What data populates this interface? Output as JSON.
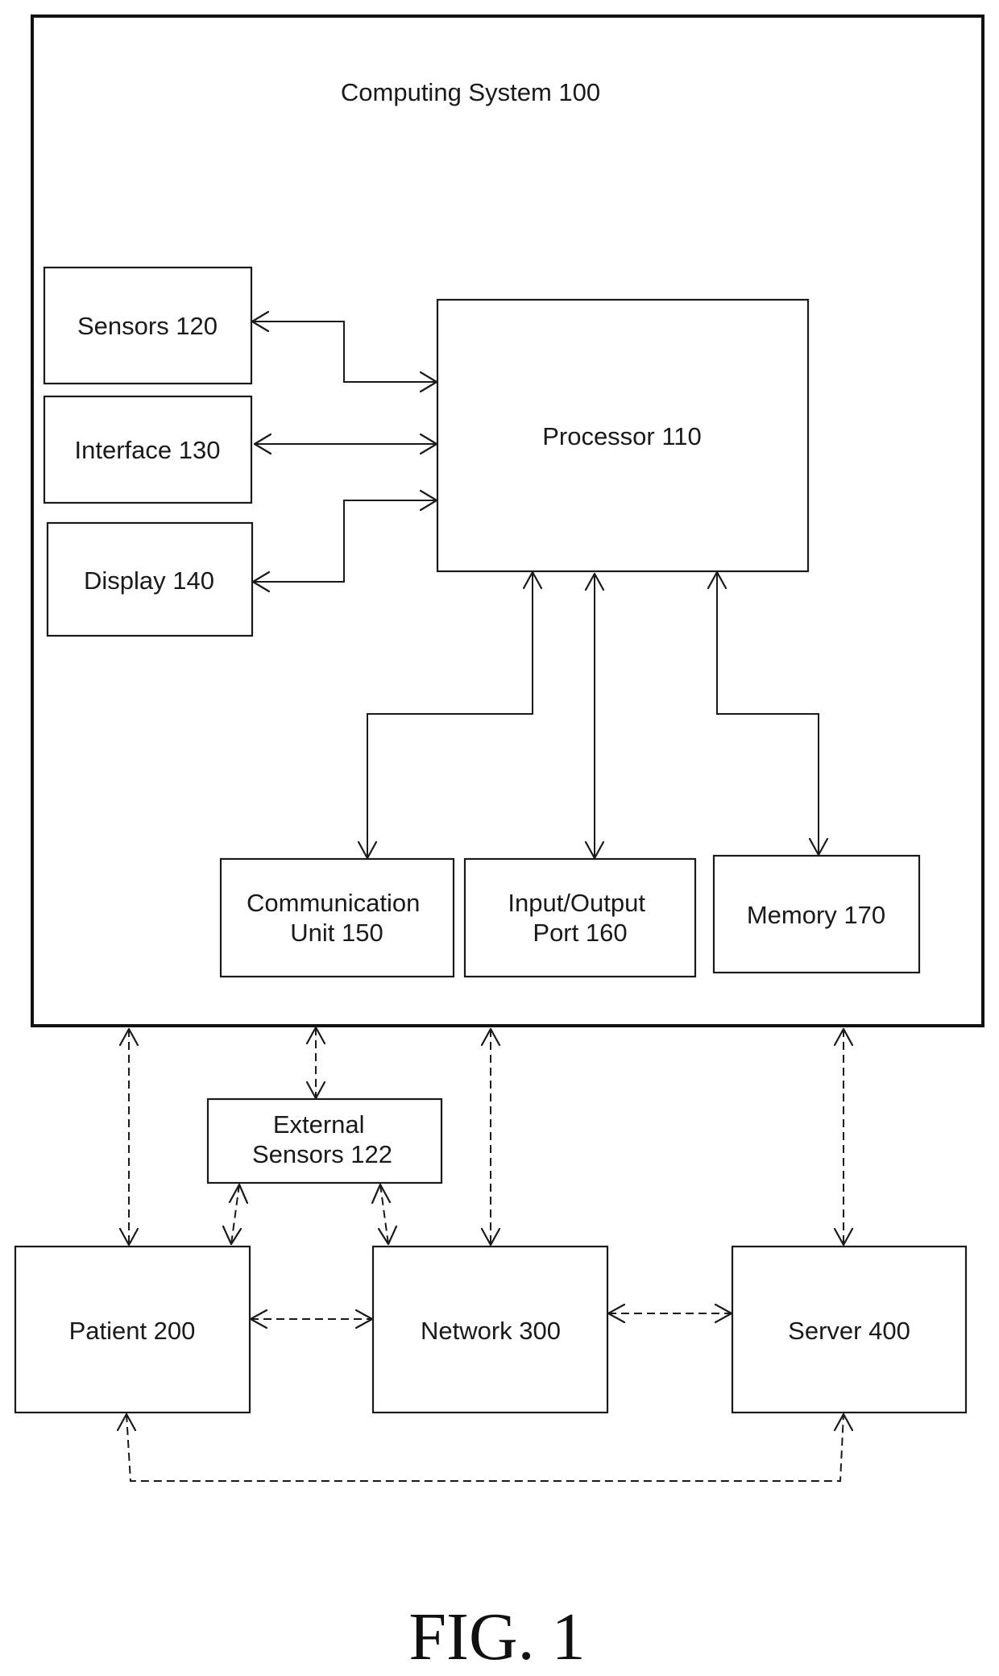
{
  "figure": {
    "caption": "FIG. 1",
    "system_title": "Computing System 100"
  },
  "blocks": {
    "sensors": "Sensors 120",
    "interface": "Interface 130",
    "display": "Display 140",
    "processor": "Processor 110",
    "communication_unit": [
      "Communication",
      "Unit 150"
    ],
    "io_port": [
      "Input/Output",
      "Port 160"
    ],
    "memory": "Memory 170",
    "external_sensors": [
      "External",
      "Sensors 122"
    ],
    "patient": "Patient 200",
    "network": "Network 300",
    "server": "Server 400"
  },
  "connections": [
    {
      "from": "Sensors 120",
      "to": "Processor 110",
      "style": "solid",
      "bidirectional": true
    },
    {
      "from": "Interface 130",
      "to": "Processor 110",
      "style": "solid",
      "bidirectional": true
    },
    {
      "from": "Display 140",
      "to": "Processor 110",
      "style": "solid",
      "bidirectional": true
    },
    {
      "from": "Processor 110",
      "to": "Communication Unit 150",
      "style": "solid",
      "bidirectional": true
    },
    {
      "from": "Processor 110",
      "to": "Input/Output Port 160",
      "style": "solid",
      "bidirectional": true
    },
    {
      "from": "Processor 110",
      "to": "Memory 170",
      "style": "solid",
      "bidirectional": true
    },
    {
      "from": "Computing System 100",
      "to": "Patient 200",
      "style": "dashed",
      "bidirectional": true
    },
    {
      "from": "Computing System 100",
      "to": "External Sensors 122",
      "style": "dashed",
      "bidirectional": true
    },
    {
      "from": "Computing System 100",
      "to": "Network 300",
      "style": "dashed",
      "bidirectional": true
    },
    {
      "from": "Computing System 100",
      "to": "Server 400",
      "style": "dashed",
      "bidirectional": true
    },
    {
      "from": "External Sensors 122",
      "to": "Patient 200",
      "style": "dashed",
      "bidirectional": true
    },
    {
      "from": "External Sensors 122",
      "to": "Network 300",
      "style": "dashed",
      "bidirectional": true
    },
    {
      "from": "Patient 200",
      "to": "Network 300",
      "style": "dashed",
      "bidirectional": true
    },
    {
      "from": "Network 300",
      "to": "Server 400",
      "style": "dashed",
      "bidirectional": true
    },
    {
      "from": "Patient 200",
      "to": "Server 400",
      "style": "dashed",
      "bidirectional": true
    }
  ]
}
